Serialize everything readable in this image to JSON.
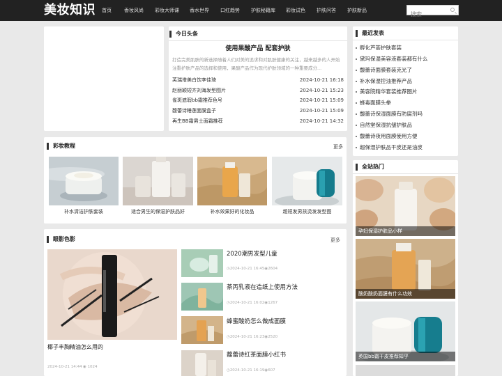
{
  "site": {
    "logo": "美妆知识"
  },
  "nav": [
    "首页",
    "香妆风尚",
    "彩妆大师课",
    "香水世界",
    "口红趋势",
    "护肤秘籍库",
    "彩妆试色",
    "护肤问答",
    "护肤新品"
  ],
  "search": {
    "placeholder": "搜索"
  },
  "headline": {
    "section_title": "今日头条",
    "title": "使用果酸产品 配套护肤",
    "desc": "打造完美肌肤的新选择随着人们对美的追求和对肌肤健康的关注，越来越多的人开始注重护肤产品的选择和使用，果酸产品作为现代护肤领域的一种重要成分...",
    "items": [
      {
        "title": "芙瑞塔美白饮李佳琦",
        "time": "2024-10-21 16:18"
      },
      {
        "title": "赵丽颖短齐刘海发型图片",
        "time": "2024-10-21 15:23"
      },
      {
        "title": "雀斑遮瑕bb霜推荐色号",
        "time": "2024-10-21 15:09"
      },
      {
        "title": "馥蕾诗睡莲面膜盒子",
        "time": "2024-10-21 15:09"
      },
      {
        "title": "再生BB霜男士面霜推荐",
        "time": "2024-10-21 14:32"
      }
    ]
  },
  "recent": {
    "section_title": "最近发表",
    "items": [
      "孵化芦荟护肤套装",
      "黛玛保湿美容液套装都有什么",
      "馥蕾诗面膜套装克光了",
      "补水保湿控油推荐产品",
      "美容院精华套装推荐图片",
      "蜂毒面膜头拳",
      "馥蕾诗保湿面膜有防腐剂吗",
      "自然堂保湿抗皱护肤品",
      "馥蕾诗夜用面膜使用方便",
      "超保湿护肤品干皮还是油皮"
    ]
  },
  "tutorial": {
    "section_title": "彩妆教程",
    "more": "更多",
    "items": [
      "补水清洁护肤套装",
      "适合男生的保湿护肤品好",
      "补水效果好的化妆品",
      "超短发男孩烫发发型图"
    ]
  },
  "hot": {
    "section_title": "全站热门",
    "items": [
      "孕妇保湿护肤品小样",
      "酸奶酸奶面膜有什么功效",
      "英国bb霜干皮推荐知乎"
    ]
  },
  "shadow": {
    "section_title": "眼影色影",
    "more": "更多",
    "main_title": "椰子丰胸精油怎么用的",
    "main_time": "2024-10-21 14:44",
    "main_views": "1024",
    "items": [
      {
        "title": "2020潮男发型儿童",
        "meta": "2024-10-21 16:45",
        "views": "2604"
      },
      {
        "title": "茶丙乳液在造纸上使用方法",
        "meta": "2024-10-21 16:02",
        "views": "1267"
      },
      {
        "title": "蜂蜜酸奶怎么做成面膜",
        "meta": "2024-10-21 16:23",
        "views": "2520"
      },
      {
        "title": "馥蕾诗红茶面膜小红书",
        "meta": "2024-10-21 16:19",
        "views": "607"
      }
    ]
  },
  "colors": {
    "header_bg": "#222222",
    "page_bg": "#e9e9e9",
    "panel_bg": "#ffffff"
  }
}
